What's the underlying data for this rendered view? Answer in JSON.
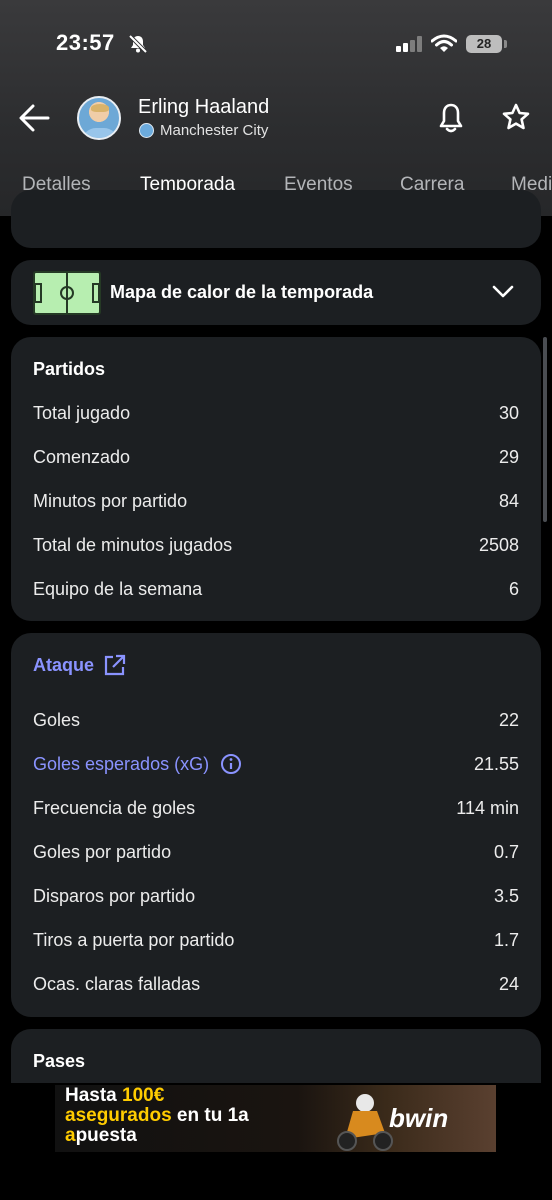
{
  "status": {
    "time": "23:57",
    "battery": "28"
  },
  "player": {
    "name": "Erling Haaland",
    "team": "Manchester City"
  },
  "tabs": [
    "Detalles",
    "Temporada",
    "Eventos",
    "Carrera",
    "Medi"
  ],
  "heatmap": {
    "title": "Mapa de calor de la temporada"
  },
  "partidos": {
    "title": "Partidos",
    "rows": [
      {
        "label": "Total jugado",
        "value": "30"
      },
      {
        "label": "Comenzado",
        "value": "29"
      },
      {
        "label": "Minutos por partido",
        "value": "84"
      },
      {
        "label": "Total de minutos jugados",
        "value": "2508"
      },
      {
        "label": "Equipo de la semana",
        "value": "6"
      }
    ]
  },
  "ataque": {
    "title": "Ataque",
    "rows": [
      {
        "label": "Goles",
        "value": "22"
      },
      {
        "label": "Goles esperados (xG)",
        "value": "21.55"
      },
      {
        "label": "Frecuencia de goles",
        "value": "114 min"
      },
      {
        "label": "Goles por partido",
        "value": "0.7"
      },
      {
        "label": "Disparos por partido",
        "value": "3.5"
      },
      {
        "label": "Tiros a puerta por partido",
        "value": "1.7"
      },
      {
        "label": "Ocas. claras falladas",
        "value": "24"
      }
    ]
  },
  "pases": {
    "title": "Pases"
  },
  "ad": {
    "line1a": "Hasta ",
    "line1b": "100€",
    "line2a": "asegurados",
    "line2b": " en tu 1a",
    "line3a": "a",
    "line3b": "puesta",
    "brand": "bwin"
  },
  "colors": {
    "accent": "#8a93ff",
    "card": "#1c1f22",
    "background": "#000000"
  }
}
